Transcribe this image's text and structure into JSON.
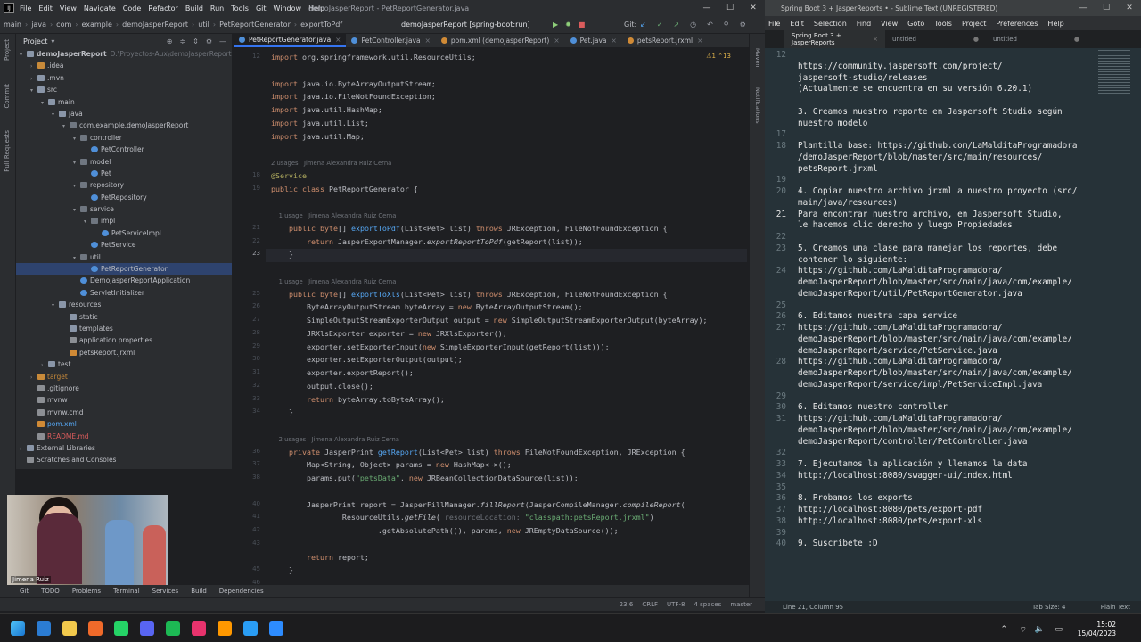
{
  "ide": {
    "title": "demoJasperReport - PetReportGenerator.java",
    "menu": [
      "File",
      "Edit",
      "View",
      "Navigate",
      "Code",
      "Refactor",
      "Build",
      "Run",
      "Tools",
      "Git",
      "Window",
      "Help"
    ],
    "breadcrumb": [
      "main",
      "java",
      "com",
      "example",
      "demoJasperReport",
      "util",
      "PetReportGenerator",
      "exportToPdf"
    ],
    "run_config": "demoJasperReport [spring-boot:run]",
    "git_label": "Git:",
    "project_label": "Project",
    "tree": [
      {
        "label": "demoJasperReport",
        "hint": "D:\\Proyectos-Aux\\demoJasperReport",
        "depth": 0,
        "icon": "folder",
        "open": true,
        "bold": true
      },
      {
        "label": ".idea",
        "depth": 1,
        "icon": "orange",
        "open": false
      },
      {
        "label": ".mvn",
        "depth": 1,
        "icon": "folder",
        "open": false
      },
      {
        "label": "src",
        "depth": 1,
        "icon": "folder",
        "open": true
      },
      {
        "label": "main",
        "depth": 2,
        "icon": "folder",
        "open": true
      },
      {
        "label": "java",
        "depth": 3,
        "icon": "folder",
        "open": true
      },
      {
        "label": "com.example.demoJasperReport",
        "depth": 4,
        "icon": "pkg",
        "open": true
      },
      {
        "label": "controller",
        "depth": 5,
        "icon": "pkg",
        "open": true
      },
      {
        "label": "PetController",
        "depth": 6,
        "icon": "cls"
      },
      {
        "label": "model",
        "depth": 5,
        "icon": "pkg",
        "open": true
      },
      {
        "label": "Pet",
        "depth": 6,
        "icon": "cls"
      },
      {
        "label": "repository",
        "depth": 5,
        "icon": "pkg",
        "open": true
      },
      {
        "label": "PetRepository",
        "depth": 6,
        "icon": "cls"
      },
      {
        "label": "service",
        "depth": 5,
        "icon": "pkg",
        "open": true
      },
      {
        "label": "impl",
        "depth": 6,
        "icon": "pkg",
        "open": true
      },
      {
        "label": "PetServiceImpl",
        "depth": 7,
        "icon": "cls"
      },
      {
        "label": "PetService",
        "depth": 6,
        "icon": "cls"
      },
      {
        "label": "util",
        "depth": 5,
        "icon": "pkg",
        "open": true
      },
      {
        "label": "PetReportGenerator",
        "depth": 6,
        "icon": "cls",
        "selected": true
      },
      {
        "label": "DemoJasperReportApplication",
        "depth": 5,
        "icon": "cls"
      },
      {
        "label": "ServletInitializer",
        "depth": 5,
        "icon": "cls"
      },
      {
        "label": "resources",
        "depth": 3,
        "icon": "folder",
        "open": true
      },
      {
        "label": "static",
        "depth": 4,
        "icon": "folder"
      },
      {
        "label": "templates",
        "depth": 4,
        "icon": "folder"
      },
      {
        "label": "application.properties",
        "depth": 4,
        "icon": "file"
      },
      {
        "label": "petsReport.jrxml",
        "depth": 4,
        "icon": "xml"
      },
      {
        "label": "test",
        "depth": 2,
        "icon": "folder",
        "open": false
      },
      {
        "label": "target",
        "depth": 1,
        "icon": "orange",
        "open": false,
        "muted": true
      },
      {
        "label": ".gitignore",
        "depth": 1,
        "icon": "file"
      },
      {
        "label": "mvnw",
        "depth": 1,
        "icon": "file"
      },
      {
        "label": "mvnw.cmd",
        "depth": 1,
        "icon": "file"
      },
      {
        "label": "pom.xml",
        "depth": 1,
        "icon": "xml",
        "blue": true
      },
      {
        "label": "README.md",
        "depth": 1,
        "icon": "file",
        "red": true
      },
      {
        "label": "External Libraries",
        "depth": 0,
        "icon": "folder",
        "open": false
      },
      {
        "label": "Scratches and Consoles",
        "depth": 0,
        "icon": "file"
      }
    ],
    "tabs": [
      {
        "label": "PetReportGenerator.java",
        "active": true,
        "color": "#4f8fd8"
      },
      {
        "label": "PetController.java",
        "color": "#4f8fd8"
      },
      {
        "label": "pom.xml (demoJasperReport)",
        "color": "#d08a36"
      },
      {
        "label": "Pet.java",
        "color": "#4f8fd8"
      },
      {
        "label": "petsReport.jrxml",
        "color": "#d08a36"
      }
    ],
    "inspection": "⚠1  ⌃13",
    "gutter_numbers": [
      "12",
      "",
      "",
      "",
      "",
      "",
      "",
      "",
      "",
      "18",
      "19",
      "",
      "",
      "21",
      "22",
      "23",
      "",
      "",
      "25",
      "26",
      "27",
      "28",
      "29",
      "30",
      "31",
      "32",
      "33",
      "34",
      "",
      "",
      "36",
      "37",
      "38",
      "",
      "40",
      "41",
      "42",
      "43",
      "",
      "45",
      "46"
    ],
    "code": [
      {
        "kind": "code",
        "html": "<span class='kw'>import</span> org.springframework.util.ResourceUtils;"
      },
      {
        "kind": "blank"
      },
      {
        "kind": "code",
        "html": "<span class='kw'>import</span> java.io.ByteArrayOutputStream;"
      },
      {
        "kind": "code",
        "html": "<span class='kw'>import</span> java.io.FileNotFoundException;"
      },
      {
        "kind": "code",
        "html": "<span class='kw'>import</span> java.util.HashMap;"
      },
      {
        "kind": "code",
        "html": "<span class='kw'>import</span> java.util.List;"
      },
      {
        "kind": "code",
        "html": "<span class='kw'>import</span> java.util.Map;"
      },
      {
        "kind": "blank"
      },
      {
        "kind": "hint",
        "text": "2 usages   Jimena Alexandra Ruiz Cerna"
      },
      {
        "kind": "code",
        "html": "<span class='an'>@Service</span>"
      },
      {
        "kind": "code",
        "html": "<span class='kw'>public class</span> PetReportGenerator {"
      },
      {
        "kind": "blank"
      },
      {
        "kind": "hint",
        "text": "    1 usage   Jimena Alexandra Ruiz Cerna"
      },
      {
        "kind": "code",
        "html": "    <span class='kw'>public</span> <span class='kw'>byte</span>[] <span class='fn'>exportToPdf</span>(List&lt;Pet&gt; list) <span class='kw'>throws</span> JRException, FileNotFoundException {"
      },
      {
        "kind": "code",
        "html": "        <span class='kw'>return</span> JasperExportManager.<span class='it'>exportReportToPdf</span>(getReport(list));"
      },
      {
        "kind": "code",
        "html": "    }"
      },
      {
        "kind": "blank"
      },
      {
        "kind": "hint",
        "text": "    1 usage   Jimena Alexandra Ruiz Cerna"
      },
      {
        "kind": "code",
        "html": "    <span class='kw'>public</span> <span class='kw'>byte</span>[] <span class='fn'>exportToXls</span>(List&lt;Pet&gt; list) <span class='kw'>throws</span> JRException, FileNotFoundException {"
      },
      {
        "kind": "code",
        "html": "        ByteArrayOutputStream byteArray = <span class='kw'>new</span> ByteArrayOutputStream();"
      },
      {
        "kind": "code",
        "html": "        SimpleOutputStreamExporterOutput output = <span class='kw'>new</span> SimpleOutputStreamExporterOutput(byteArray);"
      },
      {
        "kind": "code",
        "html": "        JRXlsExporter exporter = <span class='kw'>new</span> JRXlsExporter();"
      },
      {
        "kind": "code",
        "html": "        exporter.setExporterInput(<span class='kw'>new</span> SimpleExporterInput(getReport(list)));"
      },
      {
        "kind": "code",
        "html": "        exporter.setExporterOutput(output);"
      },
      {
        "kind": "code",
        "html": "        exporter.exportReport();"
      },
      {
        "kind": "code",
        "html": "        output.close();"
      },
      {
        "kind": "code",
        "html": "        <span class='kw'>return</span> byteArray.toByteArray();"
      },
      {
        "kind": "code",
        "html": "    }"
      },
      {
        "kind": "blank"
      },
      {
        "kind": "hint",
        "text": "    2 usages   Jimena Alexandra Ruiz Cerna"
      },
      {
        "kind": "code",
        "html": "    <span class='kw'>private</span> JasperPrint <span class='fn'>getReport</span>(List&lt;Pet&gt; list) <span class='kw'>throws</span> FileNotFoundException, JRException {"
      },
      {
        "kind": "code",
        "html": "        Map&lt;String, Object&gt; params = <span class='kw'>new</span> HashMap&lt;~&gt;();"
      },
      {
        "kind": "code",
        "html": "        params.put(<span class='str'>\"petsData\"</span>, <span class='kw'>new</span> JRBeanCollectionDataSource(list));"
      },
      {
        "kind": "blank"
      },
      {
        "kind": "code",
        "html": "        JasperPrint report = JasperFillManager.<span class='it'>fillReport</span>(JasperCompileManager.<span class='it'>compileReport</span>("
      },
      {
        "kind": "code",
        "html": "                ResourceUtils.<span class='it'>getFile</span>( <span class='pm'>resourceLocation:</span> <span class='str'>\"classpath:petsReport.jrxml\"</span>)"
      },
      {
        "kind": "code",
        "html": "                        .getAbsolutePath()), params, <span class='kw'>new</span> JREmptyDataSource());"
      },
      {
        "kind": "blank"
      },
      {
        "kind": "code",
        "html": "        <span class='kw'>return</span> report;"
      },
      {
        "kind": "code",
        "html": "    }"
      }
    ],
    "tool_windows": [
      "Git",
      "TODO",
      "Problems",
      "Terminal",
      "Services",
      "Build",
      "Dependencies"
    ],
    "status": [
      "23:6",
      "CRLF",
      "UTF-8",
      "4 spaces",
      "master"
    ],
    "left_labels": [
      "Project",
      "Commit",
      "Pull Requests"
    ],
    "right_labels": [
      "Maven",
      "Notifications"
    ],
    "webcam_name": "Jimena Ruiz"
  },
  "sublime": {
    "title": "Spring Boot 3 + JasperReports • - Sublime Text (UNREGISTERED)",
    "menu": [
      "File",
      "Edit",
      "Selection",
      "Find",
      "View",
      "Goto",
      "Tools",
      "Project",
      "Preferences",
      "Help"
    ],
    "tabs": [
      {
        "label": "Spring Boot 3 + JasperReports",
        "active": true
      },
      {
        "label": "untitled"
      },
      {
        "label": "untitled"
      }
    ],
    "rows": [
      {
        "n": "12",
        "t": ""
      },
      {
        "n": "",
        "t": "https://community.jaspersoft.com/project/"
      },
      {
        "n": "",
        "t": "jaspersoft-studio/releases"
      },
      {
        "n": "",
        "t": "(Actualmente se encuentra en su versión 6.20.1)"
      },
      {
        "n": "",
        "t": ""
      },
      {
        "n": "",
        "t": "3. Creamos nuestro reporte en Jaspersoft Studio según"
      },
      {
        "n": "",
        "t": "nuestro modelo"
      },
      {
        "n": "17",
        "t": ""
      },
      {
        "n": "18",
        "t": "Plantilla base: https://github.com/LaMalditaProgramadora"
      },
      {
        "n": "",
        "t": "/demoJasperReport/blob/master/src/main/resources/"
      },
      {
        "n": "",
        "t": "petsReport.jrxml"
      },
      {
        "n": "19",
        "t": ""
      },
      {
        "n": "20",
        "t": "4. Copiar nuestro archivo jrxml a nuestro proyecto (src/"
      },
      {
        "n": "",
        "t": "main/java/resources)"
      },
      {
        "n": "21",
        "t": "Para encontrar nuestro archivo, en Jaspersoft Studio,",
        "cur": true
      },
      {
        "n": "",
        "t": "le hacemos clic derecho y luego Propiedades"
      },
      {
        "n": "22",
        "t": ""
      },
      {
        "n": "23",
        "t": "5. Creamos una clase para manejar los reportes, debe"
      },
      {
        "n": "",
        "t": "contener lo siguiente:"
      },
      {
        "n": "24",
        "t": "https://github.com/LaMalditaProgramadora/"
      },
      {
        "n": "",
        "t": "demoJasperReport/blob/master/src/main/java/com/example/"
      },
      {
        "n": "",
        "t": "demoJasperReport/util/PetReportGenerator.java"
      },
      {
        "n": "25",
        "t": ""
      },
      {
        "n": "26",
        "t": "6. Editamos nuestra capa service"
      },
      {
        "n": "27",
        "t": "https://github.com/LaMalditaProgramadora/"
      },
      {
        "n": "",
        "t": "demoJasperReport/blob/master/src/main/java/com/example/"
      },
      {
        "n": "",
        "t": "demoJasperReport/service/PetService.java"
      },
      {
        "n": "28",
        "t": "https://github.com/LaMalditaProgramadora/"
      },
      {
        "n": "",
        "t": "demoJasperReport/blob/master/src/main/java/com/example/"
      },
      {
        "n": "",
        "t": "demoJasperReport/service/impl/PetServiceImpl.java"
      },
      {
        "n": "29",
        "t": ""
      },
      {
        "n": "30",
        "t": "6. Editamos nuestro controller"
      },
      {
        "n": "31",
        "t": "https://github.com/LaMalditaProgramadora/"
      },
      {
        "n": "",
        "t": "demoJasperReport/blob/master/src/main/java/com/example/"
      },
      {
        "n": "",
        "t": "demoJasperReport/controller/PetController.java"
      },
      {
        "n": "32",
        "t": ""
      },
      {
        "n": "33",
        "t": "7. Ejecutamos la aplicación y llenamos la data"
      },
      {
        "n": "34",
        "t": "http://localhost:8080/swagger-ui/index.html"
      },
      {
        "n": "35",
        "t": ""
      },
      {
        "n": "36",
        "t": "8. Probamos los exports"
      },
      {
        "n": "37",
        "t": "http://localhost:8080/pets/export-pdf"
      },
      {
        "n": "38",
        "t": "http://localhost:8080/pets/export-xls"
      },
      {
        "n": "39",
        "t": ""
      },
      {
        "n": "40",
        "t": "9. Suscríbete :D"
      }
    ],
    "status_left": "Line 21, Column 95",
    "status_mid": "Tab Size: 4",
    "status_right": "Plain Text"
  },
  "taskbar": {
    "time": "15:02",
    "date": "15/04/2023",
    "apps": [
      "windows-start",
      "mail",
      "file-explorer",
      "brave",
      "whatsapp",
      "discord",
      "spotify",
      "intellij",
      "sublime",
      "vscode",
      "zoom"
    ]
  }
}
